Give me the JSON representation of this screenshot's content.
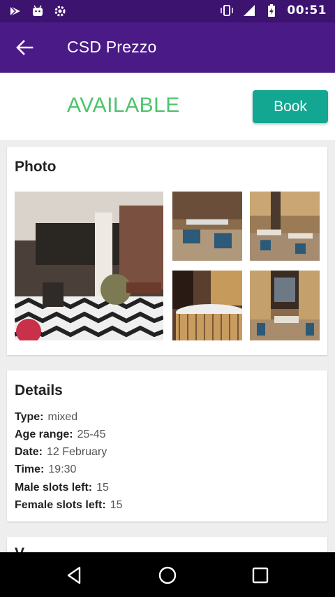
{
  "status_bar": {
    "time": "00:51"
  },
  "app_bar": {
    "title": "CSD Prezzo"
  },
  "availability": {
    "status": "AVAILABLE",
    "book_label": "Book"
  },
  "photo_section": {
    "title": "Photo"
  },
  "details": {
    "title": "Details",
    "rows": [
      {
        "label": "Type:",
        "value": "mixed"
      },
      {
        "label": "Age range:",
        "value": "25-45"
      },
      {
        "label": "Date:",
        "value": "12 February"
      },
      {
        "label": "Time:",
        "value": "19:30"
      },
      {
        "label": "Male slots left:",
        "value": "15"
      },
      {
        "label": "Female slots left:",
        "value": "15"
      }
    ]
  },
  "venue_section": {
    "title": "V"
  },
  "colors": {
    "app_bar": "#4a1a86",
    "status_bar": "#3d1370",
    "available": "#4cc46b",
    "book_button": "#13a792"
  }
}
